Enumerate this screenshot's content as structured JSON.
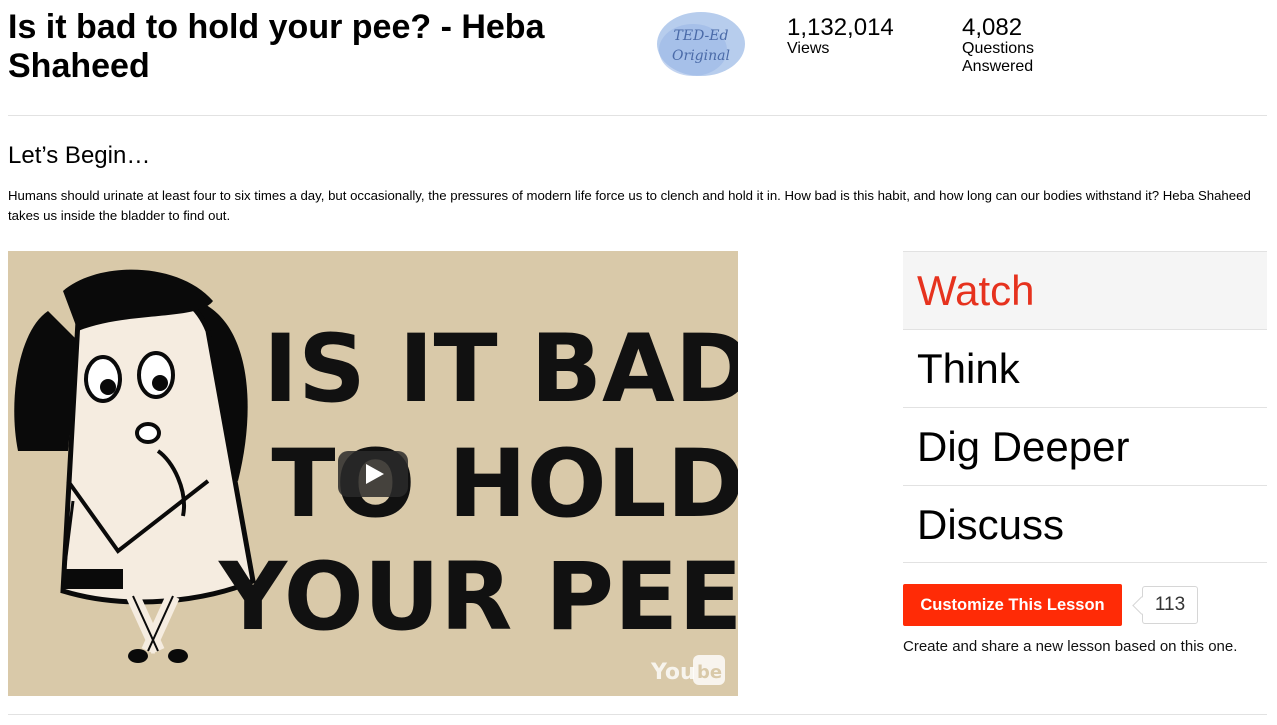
{
  "header": {
    "title": "Is it bad to hold your pee? - Heba Shaheed",
    "badge_line1": "TED-Ed",
    "badge_line2": "Original",
    "views_count": "1,132,014",
    "views_label": "Views",
    "questions_count": "4,082",
    "questions_label": "Questions Answered"
  },
  "intro": {
    "heading": "Let’s Begin…",
    "description": "Humans should urinate at least four to six times a day, but occasionally, the pressures of modern life force us to clench and hold it in. How bad is this habit, and how long can our bodies withstand it? Heba Shaheed takes us inside the bladder to find out."
  },
  "video": {
    "line1": "IS IT BAD",
    "line2": "TO HOLD",
    "line3": "YOUR PEE?",
    "youtube_logo": "YouTube",
    "play_icon": "play-icon"
  },
  "tabs": [
    "Watch",
    "Think",
    "Dig Deeper",
    "Discuss"
  ],
  "customize": {
    "button_label": "Customize This Lesson",
    "count": "113",
    "note": "Create and share a new lesson based on this one."
  },
  "colors": {
    "accent": "#ff2b06",
    "active_tab": "#e6321e",
    "video_bg": "#d9c9a9"
  }
}
